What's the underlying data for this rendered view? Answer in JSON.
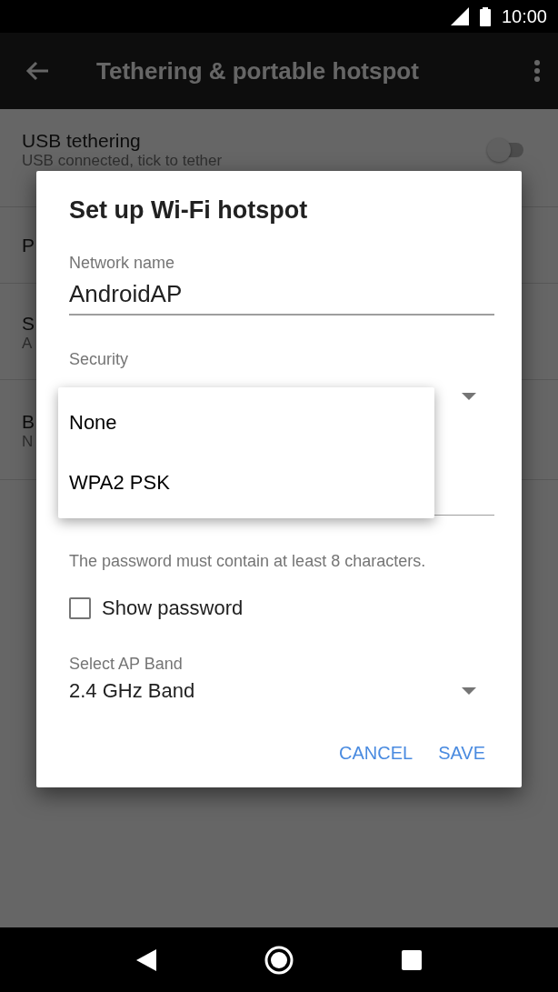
{
  "status_bar": {
    "time": "10:00"
  },
  "app_bar": {
    "title": "Tethering & portable hotspot"
  },
  "settings": [
    {
      "title": "USB tethering",
      "subtitle": "USB connected, tick to tether",
      "kind": "switch",
      "on": false
    },
    {
      "title": "P",
      "kind": "plain"
    },
    {
      "title": "S",
      "subtitle": "A",
      "kind": "plain"
    },
    {
      "title": "B",
      "subtitle": "N",
      "kind": "plain"
    }
  ],
  "dialog": {
    "title": "Set up Wi-Fi hotspot",
    "network_name": {
      "label": "Network name",
      "value": "AndroidAP"
    },
    "security": {
      "label": "Security",
      "options": [
        "None",
        "WPA2 PSK"
      ]
    },
    "password_hint": "The password must contain at least 8 characters.",
    "show_password": {
      "label": "Show password",
      "checked": false
    },
    "ap_band": {
      "label": "Select AP Band",
      "value": "2.4 GHz Band"
    },
    "buttons": [
      "CANCEL",
      "SAVE"
    ]
  }
}
